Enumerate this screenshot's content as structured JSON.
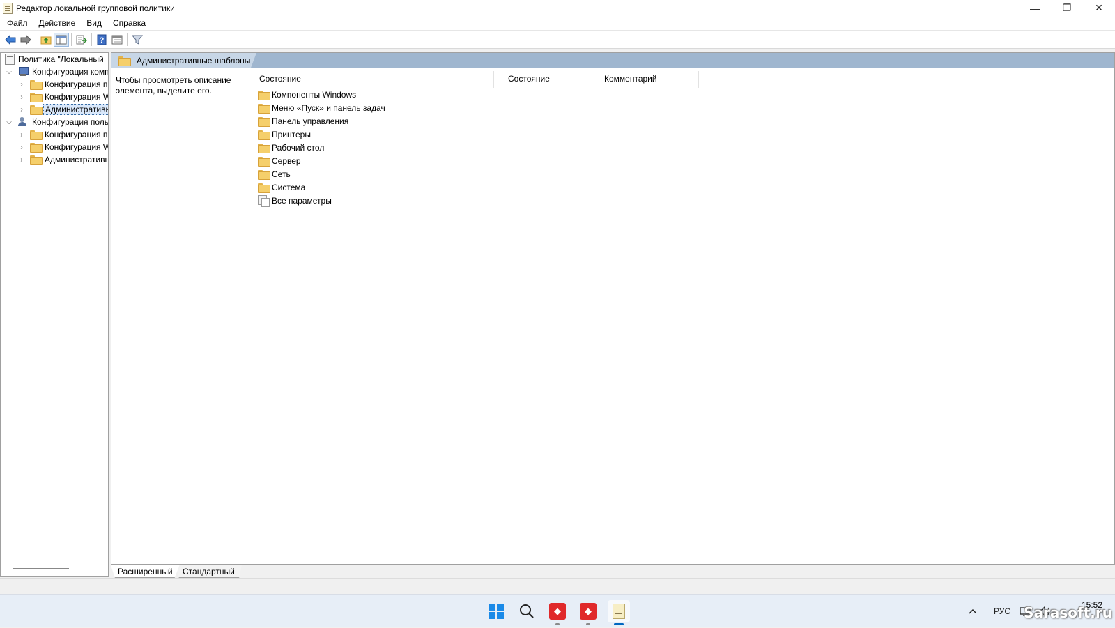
{
  "window": {
    "title": "Редактор локальной групповой политики",
    "minimize": "—",
    "restore": "❐",
    "close": "✕"
  },
  "menu": [
    "Файл",
    "Действие",
    "Вид",
    "Справка"
  ],
  "tree": {
    "root": "Политика \"Локальный",
    "items": [
      {
        "label": "Конфигурация комп",
        "level": 1,
        "expanded": true,
        "icon": "computer-icon"
      },
      {
        "label": "Конфигурация п",
        "level": 2,
        "expanded": false,
        "icon": "folder-icon"
      },
      {
        "label": "Конфигурация W",
        "level": 2,
        "expanded": false,
        "icon": "folder-icon"
      },
      {
        "label": "Административн",
        "level": 2,
        "expanded": false,
        "icon": "folder-icon",
        "selected": true
      },
      {
        "label": "Конфигурация поль",
        "level": 1,
        "expanded": true,
        "icon": "users-icon"
      },
      {
        "label": "Конфигурация п",
        "level": 2,
        "expanded": false,
        "icon": "folder-icon"
      },
      {
        "label": "Конфигурация W",
        "level": 2,
        "expanded": false,
        "icon": "folder-icon"
      },
      {
        "label": "Административн",
        "level": 2,
        "expanded": false,
        "icon": "folder-icon"
      }
    ]
  },
  "main": {
    "header_title": "Административные шаблоны",
    "description": "Чтобы просмотреть описание элемента, выделите его.",
    "columns": [
      "Состояние",
      "Состояние",
      "Комментарий"
    ],
    "items": [
      {
        "label": "Компоненты Windows",
        "icon": "folder-icon"
      },
      {
        "label": "Меню «Пуск» и панель задач",
        "icon": "folder-icon"
      },
      {
        "label": "Панель управления",
        "icon": "folder-icon"
      },
      {
        "label": "Принтеры",
        "icon": "folder-icon"
      },
      {
        "label": "Рабочий стол",
        "icon": "folder-icon"
      },
      {
        "label": "Сервер",
        "icon": "folder-icon"
      },
      {
        "label": "Сеть",
        "icon": "folder-icon"
      },
      {
        "label": "Система",
        "icon": "folder-icon"
      },
      {
        "label": "Все параметры",
        "icon": "all-settings-icon"
      }
    ]
  },
  "bottom_tabs": {
    "extended": "Расширенный",
    "standard": "Стандартный"
  },
  "taskbar": {
    "language": "РУС",
    "time": "15:52",
    "watermark": "Sarasoft.ru"
  }
}
